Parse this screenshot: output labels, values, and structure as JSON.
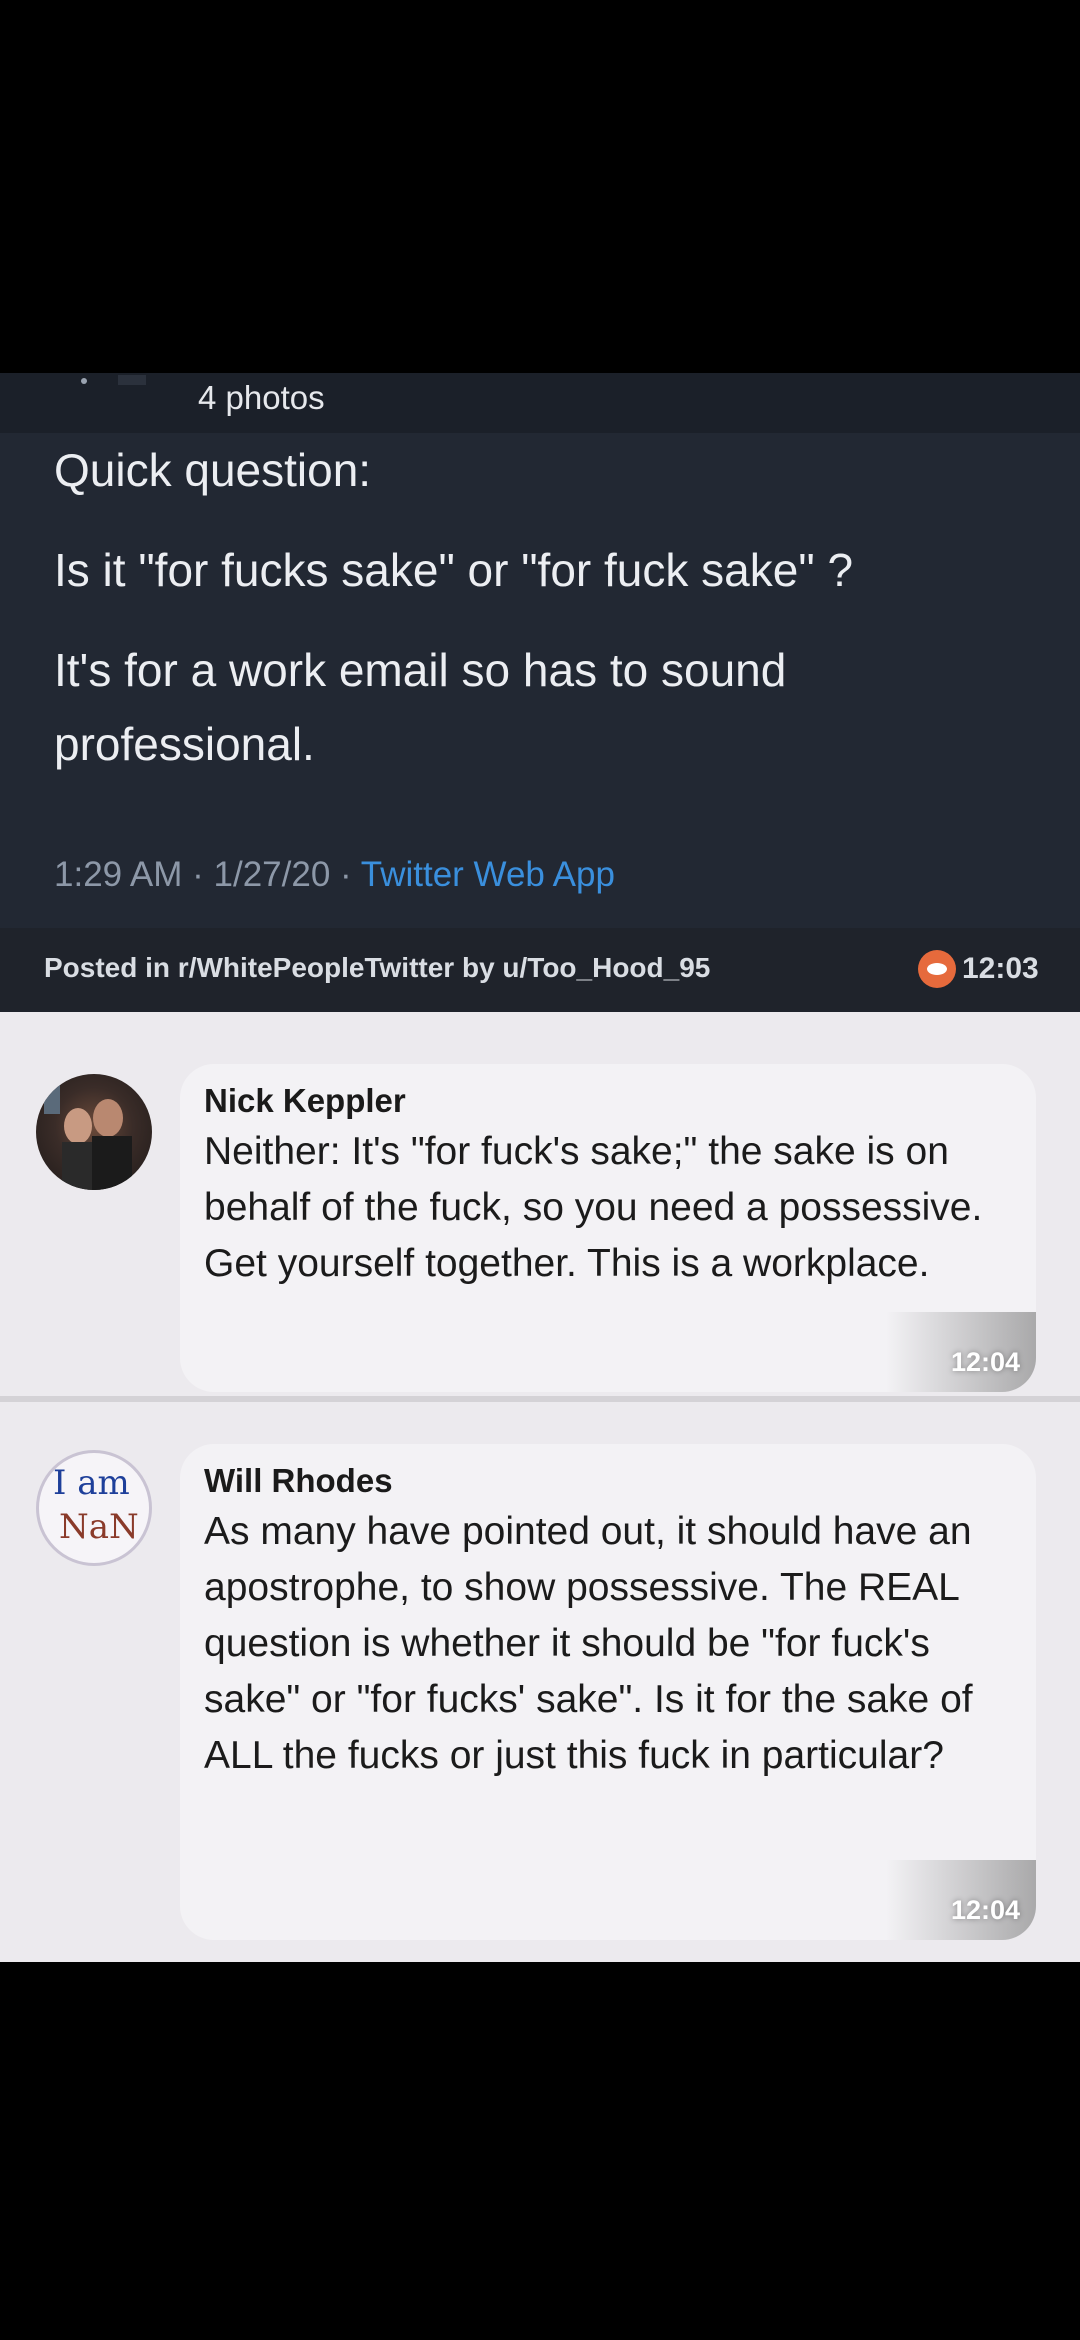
{
  "tweet": {
    "photos_label": "4 photos",
    "lines": [
      "Quick question:",
      "Is it \"for fucks sake\" or \"for fuck sake\" ?",
      "It's for a work email so has to sound",
      "professional."
    ],
    "meta_time": "1:29 AM · 1/27/20 · ",
    "meta_app": "Twitter Web App"
  },
  "reddit_bar": {
    "posted_text": "Posted in r/WhitePeopleTwitter by u/Too_Hood_95",
    "time": "12:03"
  },
  "comments": [
    {
      "author": "Nick Keppler",
      "text": "Neither: It's \"for fuck's sake;\" the sake is on behalf of the fuck, so you need a possessive. Get yourself together. This is a workplace.",
      "time": "12:04"
    },
    {
      "author": "Will Rhodes",
      "avatar_text_top": "I am",
      "avatar_text_bottom": "NaN",
      "text": "As many have pointed out, it should have an apostrophe, to show possessive. The REAL question is whether it should be \"for fuck's sake\" or \"for fucks' sake\". Is it for the sake of ALL the fucks or just this fuck in particular?",
      "time": "12:04"
    }
  ],
  "colors": {
    "tweet_bg": "#222833",
    "link_blue": "#3a8fdd",
    "reddit_orange": "#e66a3c",
    "comment_bg": "#eceaee"
  }
}
